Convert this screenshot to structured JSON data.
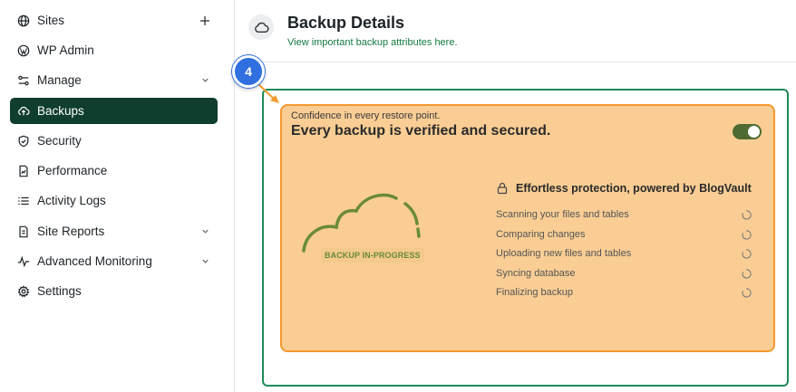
{
  "sidebar": {
    "items": [
      {
        "label": "Sites",
        "icon": "globe-icon",
        "trail": "+"
      },
      {
        "label": "WP Admin",
        "icon": "wordpress-icon",
        "trail": ""
      },
      {
        "label": "Manage",
        "icon": "manage-icon",
        "trail": "chevron"
      },
      {
        "label": "Backups",
        "icon": "cloud-upload-icon",
        "trail": "",
        "active": true
      },
      {
        "label": "Security",
        "icon": "shield-icon",
        "trail": ""
      },
      {
        "label": "Performance",
        "icon": "performance-icon",
        "trail": ""
      },
      {
        "label": "Activity Logs",
        "icon": "list-icon",
        "trail": ""
      },
      {
        "label": "Site Reports",
        "icon": "report-icon",
        "trail": "chevron"
      },
      {
        "label": "Advanced Monitoring",
        "icon": "pulse-icon",
        "trail": "chevron"
      },
      {
        "label": "Settings",
        "icon": "gear-icon",
        "trail": ""
      }
    ]
  },
  "header": {
    "title": "Backup Details",
    "subtitle": "View important backup attributes here."
  },
  "step": {
    "number": "4"
  },
  "card": {
    "kicker": "Confidence in every restore point.",
    "title": "Every backup is verified and secured.",
    "toggle_on": true,
    "badge": "BACKUP IN-PROGRESS",
    "protect_title": "Effortless protection, powered by BlogVault",
    "steps": [
      "Scanning your files and tables",
      "Comparing changes",
      "Uploading new files and tables",
      "Syncing database",
      "Finalizing backup"
    ]
  },
  "colors": {
    "accent_dark_green": "#0f3d2e",
    "outline_green": "#1e8a57",
    "card_orange": "#f9cd94",
    "card_border": "#f39a2e",
    "step_blue": "#2f6fdf"
  }
}
